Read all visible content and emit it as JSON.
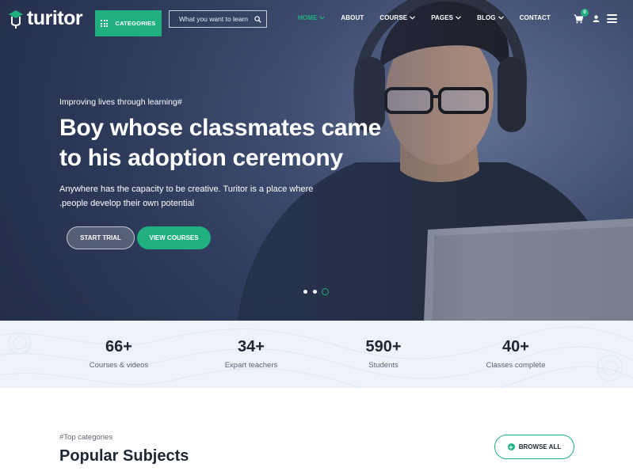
{
  "brand": {
    "name": "turitor",
    "accent": "#20b07f"
  },
  "header": {
    "categories_label": "CATEGORIES",
    "search_placeholder": "What you want to learn",
    "nav": [
      {
        "label": "HOME",
        "active": true,
        "dropdown": true
      },
      {
        "label": "ABOUT",
        "active": false,
        "dropdown": false
      },
      {
        "label": "COURSE",
        "active": false,
        "dropdown": true
      },
      {
        "label": "PAGES",
        "active": false,
        "dropdown": true
      },
      {
        "label": "BLOG",
        "active": false,
        "dropdown": true
      },
      {
        "label": "CONTACT",
        "active": false,
        "dropdown": false
      }
    ],
    "cart_count": "0",
    "icons": [
      "cart-icon",
      "user-icon",
      "menu-icon"
    ]
  },
  "hero": {
    "eyebrow": "Improving lives through learning#",
    "headline": "Boy whose classmates came to his adoption ceremony",
    "description": "Anywhere has the capacity to be creative. Turitor is a place where .people develop their own potential",
    "buttons": {
      "trial": "START TRIAL",
      "courses": "VIEW COURSES"
    },
    "slides": 3,
    "active_slide": 3
  },
  "stats": [
    {
      "value": "66+",
      "label": "Courses & videos"
    },
    {
      "value": "34+",
      "label": "Expart teachers"
    },
    {
      "value": "590+",
      "label": "Students"
    },
    {
      "value": "40+",
      "label": "Classes complete"
    }
  ],
  "categories_section": {
    "eyebrow": "#Top categories",
    "title": "Popular Subjects",
    "browse_label": "BROWSE ALL"
  }
}
